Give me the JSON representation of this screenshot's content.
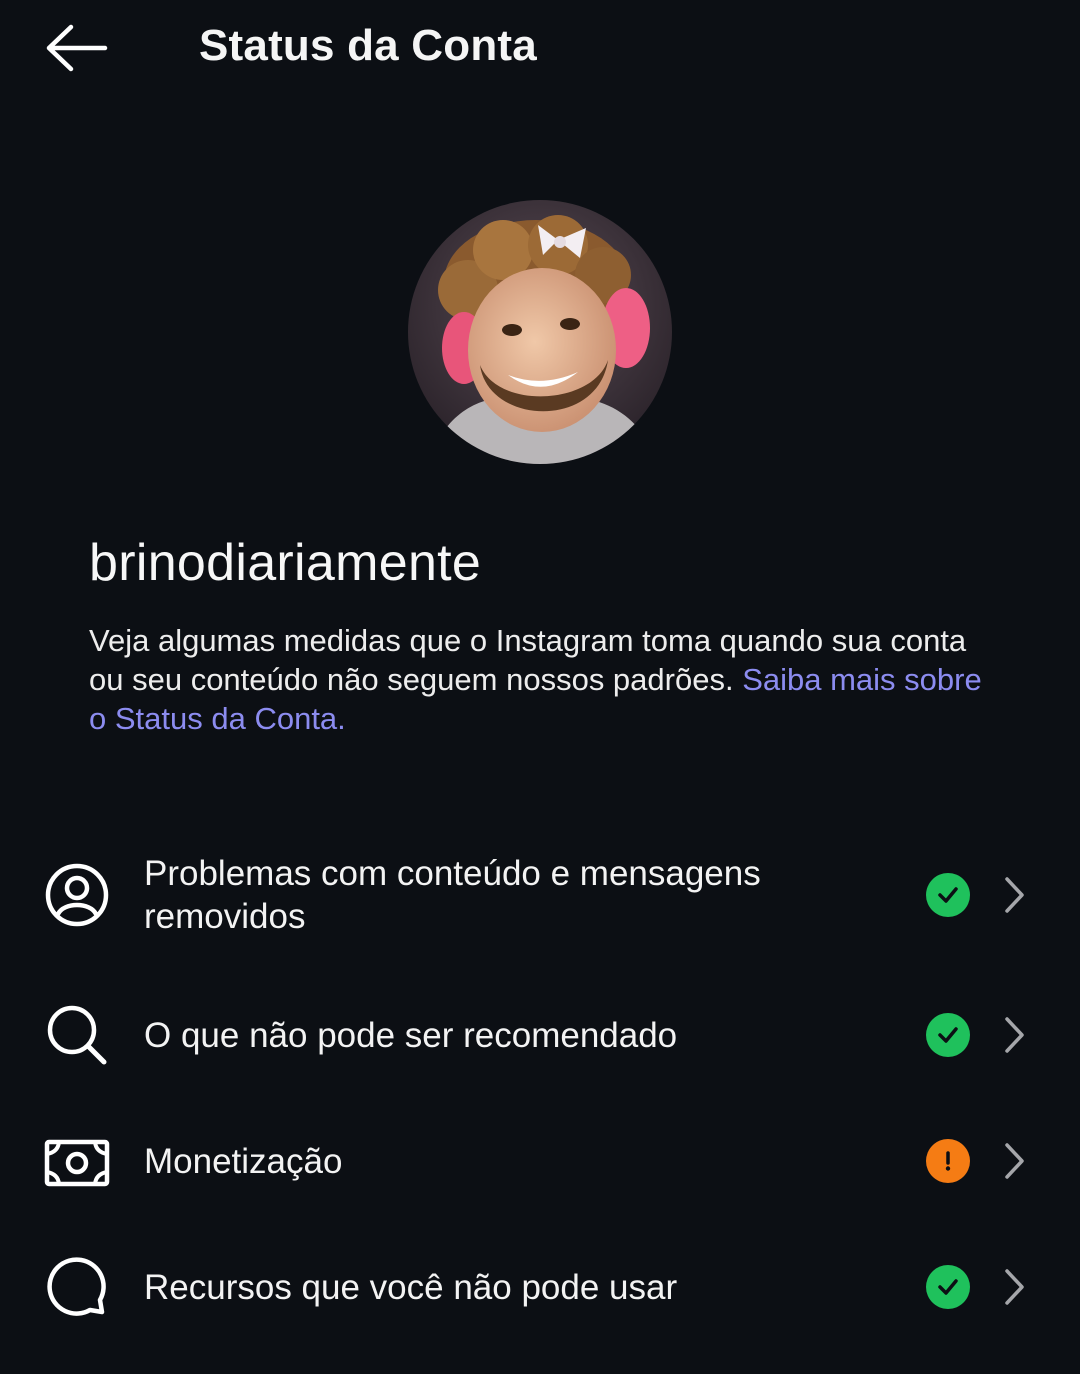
{
  "header": {
    "title": "Status da Conta",
    "back_icon": "arrow-left-icon"
  },
  "profile": {
    "username": "brinodiariamente",
    "description_text": "Veja algumas medidas que o Instagram toma quando sua conta ou seu conteúdo não seguem nossos padrões. ",
    "description_link": "Saiba mais sobre o Status da Conta."
  },
  "items": [
    {
      "label": "Problemas com conteúdo e mensagens removidos",
      "icon": "user-circle-icon",
      "status": "ok",
      "status_icon": "check-icon"
    },
    {
      "label": "O que não pode ser recomendado",
      "icon": "search-icon",
      "status": "ok",
      "status_icon": "check-icon"
    },
    {
      "label": "Monetização",
      "icon": "money-icon",
      "status": "warning",
      "status_icon": "exclamation-icon"
    },
    {
      "label": "Recursos que você não pode usar",
      "icon": "chat-bubble-icon",
      "status": "ok",
      "status_icon": "check-icon"
    }
  ],
  "colors": {
    "background": "#0c0f14",
    "text": "#f5f5f5",
    "link": "#8c8cf0",
    "status_ok": "#1fc15c",
    "status_warning": "#f57c14"
  }
}
